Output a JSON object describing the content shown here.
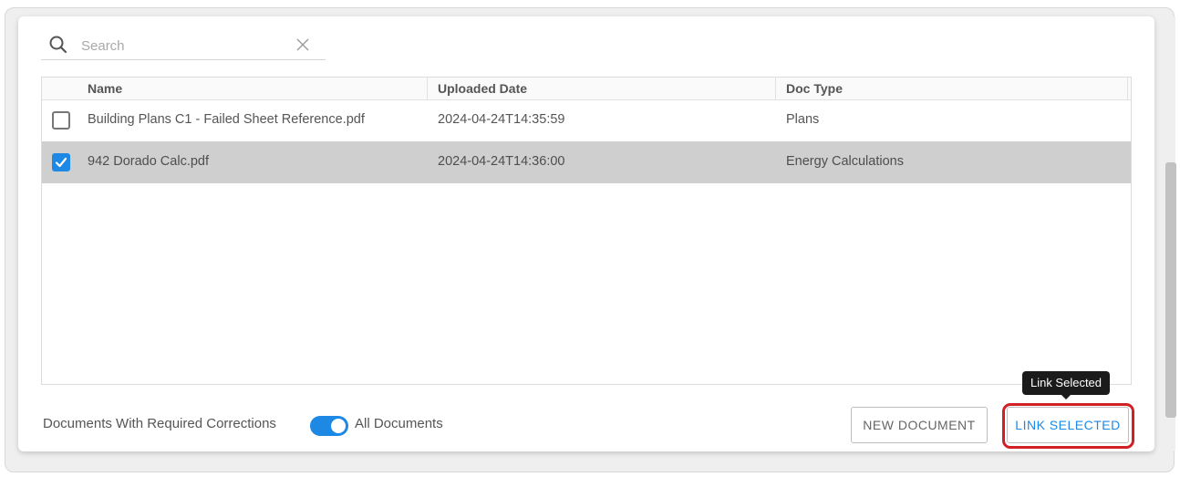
{
  "search": {
    "placeholder": "Search",
    "value": ""
  },
  "table": {
    "columns": [
      "Name",
      "Uploaded Date",
      "Doc Type"
    ],
    "rows": [
      {
        "name": "Building Plans C1 - Failed Sheet Reference.pdf",
        "uploaded": "2024-04-24T14:35:59",
        "doc_type": "Plans",
        "checked": false
      },
      {
        "name": "942 Dorado Calc.pdf",
        "uploaded": "2024-04-24T14:36:00",
        "doc_type": "Energy Calculations",
        "checked": true
      }
    ]
  },
  "footer": {
    "toggle_left_label": "Documents With Required Corrections",
    "toggle_right_label": "All Documents",
    "toggle_on": true,
    "new_document_label": "NEW DOCUMENT",
    "link_selected_label": "LINK SELECTED",
    "tooltip": "Link Selected"
  },
  "colors": {
    "accent": "#1e88e5",
    "highlight": "#d11f26",
    "selected_row": "#cfcfcf"
  },
  "icons": {
    "search": "search-icon",
    "clear": "close-icon",
    "check": "check-icon"
  }
}
